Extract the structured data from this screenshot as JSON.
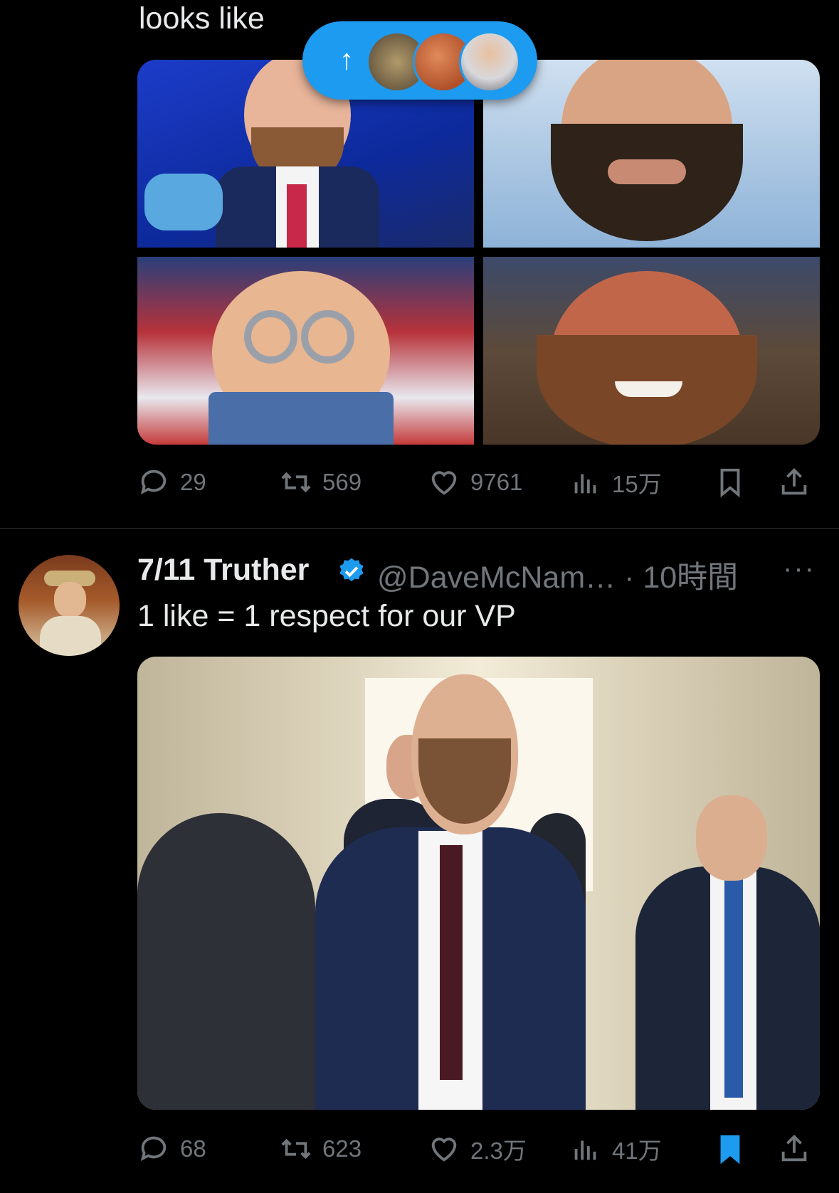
{
  "tweet1": {
    "text": "looks like",
    "stats": {
      "replies": "29",
      "retweets": "569",
      "likes": "9761",
      "views": "15万"
    }
  },
  "new_posts_pill": {
    "icon": "arrow-up-icon"
  },
  "tweet2": {
    "display_name": "7/11 Truther",
    "handle_time": "@DaveMcNam… · 10時間",
    "more": "···",
    "text": "1 like = 1 respect for our VP",
    "stats": {
      "replies": "68",
      "retweets": "623",
      "likes": "2.3万",
      "views": "41万"
    },
    "bookmarked": true
  },
  "colors": {
    "accent": "#1d9bf0",
    "muted": "#71767b",
    "text": "#e7e9ea",
    "background": "#000000"
  }
}
